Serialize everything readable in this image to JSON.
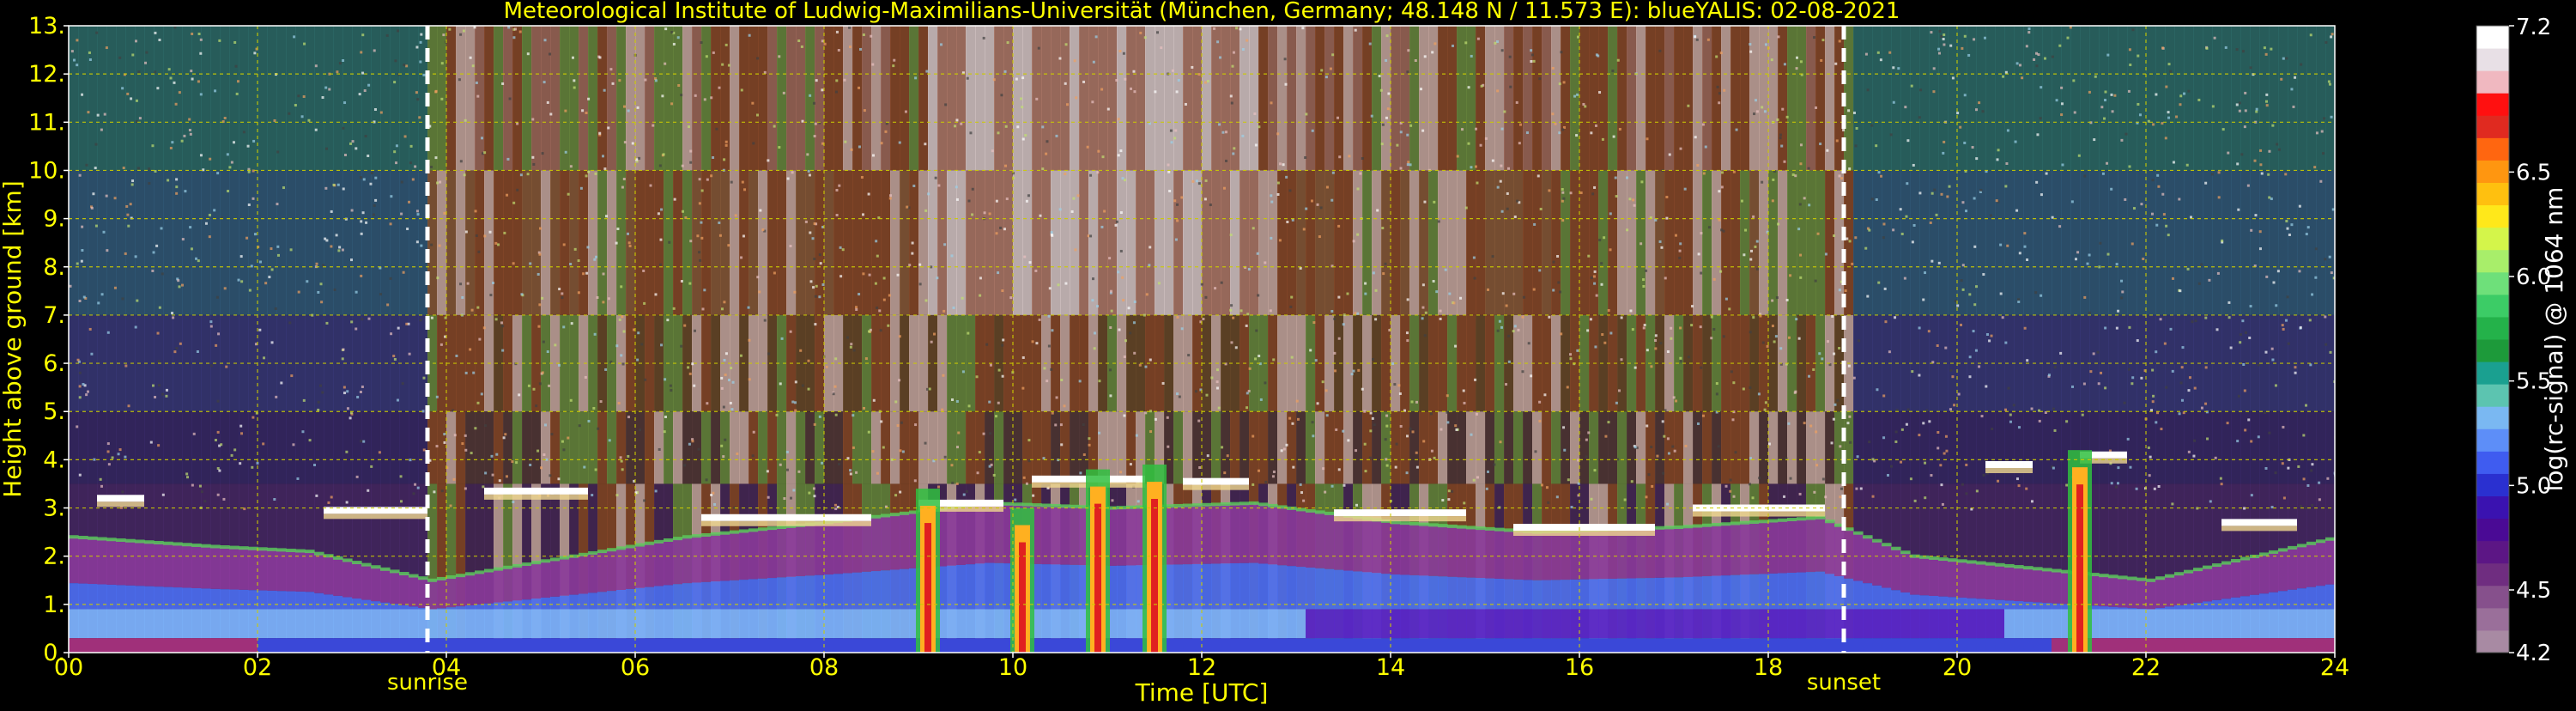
{
  "chart_data": {
    "type": "heatmap",
    "title": "Meteorological Institute of Ludwig-Maximilians-Universität (München, Germany; 48.148 N / 11.573 E):     blueYALIS: 02-08-2021",
    "xlabel": "Time [UTC]",
    "ylabel": "Height above ground [km]",
    "xlim": [
      0,
      24
    ],
    "ylim": [
      0,
      13
    ],
    "x_ticks": [
      0,
      2,
      4,
      6,
      8,
      10,
      12,
      14,
      16,
      18,
      20,
      22,
      24
    ],
    "x_tick_labels": [
      "00",
      "02",
      "04",
      "06",
      "08",
      "10",
      "12",
      "14",
      "16",
      "18",
      "20",
      "22",
      "24"
    ],
    "y_ticks": [
      0,
      1,
      2,
      3,
      4,
      5,
      6,
      7,
      8,
      9,
      10,
      11,
      12,
      13
    ],
    "y_tick_labels": [
      "0.",
      "1.",
      "2.",
      "3.",
      "4.",
      "5.",
      "6.",
      "7.",
      "8.",
      "9.",
      "10.",
      "11.",
      "12.",
      "13."
    ],
    "grid": true,
    "grid_color": "#cccc00",
    "text_color": "#ffff00",
    "background_color": "#000000",
    "colorbar": {
      "label": "log(rc-signal) @ 1064 nm",
      "range": [
        4.2,
        7.2
      ],
      "tick_values": [
        4.2,
        4.5,
        5.0,
        5.5,
        6.0,
        6.5,
        7.2
      ],
      "tick_labels": [
        "4.2",
        "4.5",
        "5.0",
        "5.5",
        "6.0",
        "6.5",
        "7.2"
      ],
      "colors": [
        "#a88aa3",
        "#9a6f9a",
        "#86508c",
        "#6f2d80",
        "#5c1685",
        "#4a0a95",
        "#3a12b0",
        "#2a30d0",
        "#3f5cf0",
        "#5d8ef8",
        "#7ab8f2",
        "#5cc4b0",
        "#1aa090",
        "#1d9a3a",
        "#24b24a",
        "#3ccc66",
        "#6ee07a",
        "#a8ee6a",
        "#d4f54a",
        "#ffe81a",
        "#ffc00f",
        "#ff9610",
        "#ff6610",
        "#e02a20",
        "#ff1010",
        "#f0b8c0",
        "#e8e0e6",
        "#ffffff"
      ]
    },
    "markers": [
      {
        "label": "sunrise",
        "x": 3.8
      },
      {
        "label": "sunset",
        "x": 18.8
      }
    ],
    "field": {
      "boundary_layer_top_km": [
        [
          0,
          2.4
        ],
        [
          1.5,
          2.2
        ],
        [
          2.5,
          2.1
        ],
        [
          3.8,
          1.5
        ],
        [
          5,
          1.9
        ],
        [
          6.5,
          2.4
        ],
        [
          8,
          2.7
        ],
        [
          9.7,
          3.1
        ],
        [
          11,
          3.0
        ],
        [
          12.5,
          3.1
        ],
        [
          14,
          2.7
        ],
        [
          15.5,
          2.5
        ],
        [
          17,
          2.6
        ],
        [
          18.5,
          2.8
        ],
        [
          19.5,
          2.0
        ],
        [
          21,
          1.7
        ],
        [
          22,
          1.5
        ],
        [
          24,
          2.4
        ]
      ],
      "cloud_layers": [
        {
          "x": [
            0.3,
            0.8
          ],
          "y": 3.2
        },
        {
          "x": [
            2.7,
            3.8
          ],
          "y": 2.95
        },
        {
          "x": [
            4.4,
            5.5
          ],
          "y": 3.35
        },
        {
          "x": [
            6.7,
            8.5
          ],
          "y": 2.8
        },
        {
          "x": [
            9.0,
            9.9
          ],
          "y": 3.1
        },
        {
          "x": [
            10.2,
            11.4
          ],
          "y": 3.6
        },
        {
          "x": [
            11.8,
            12.5
          ],
          "y": 3.55
        },
        {
          "x": [
            13.4,
            14.8
          ],
          "y": 2.9
        },
        {
          "x": [
            15.3,
            16.8
          ],
          "y": 2.6
        },
        {
          "x": [
            17.2,
            18.6
          ],
          "y": 3.0
        },
        {
          "x": [
            20.3,
            20.8
          ],
          "y": 3.9
        },
        {
          "x": [
            21.3,
            21.8
          ],
          "y": 4.1
        },
        {
          "x": [
            22.8,
            23.6
          ],
          "y": 2.7
        }
      ],
      "precipitation_columns": [
        {
          "x": 9.1,
          "top": 3.4
        },
        {
          "x": 10.1,
          "top": 3.0
        },
        {
          "x": 10.9,
          "top": 3.8
        },
        {
          "x": 11.5,
          "top": 3.9
        },
        {
          "x": 21.3,
          "top": 4.2
        }
      ],
      "midday_noise_band": [
        3.8,
        18.8
      ]
    }
  }
}
